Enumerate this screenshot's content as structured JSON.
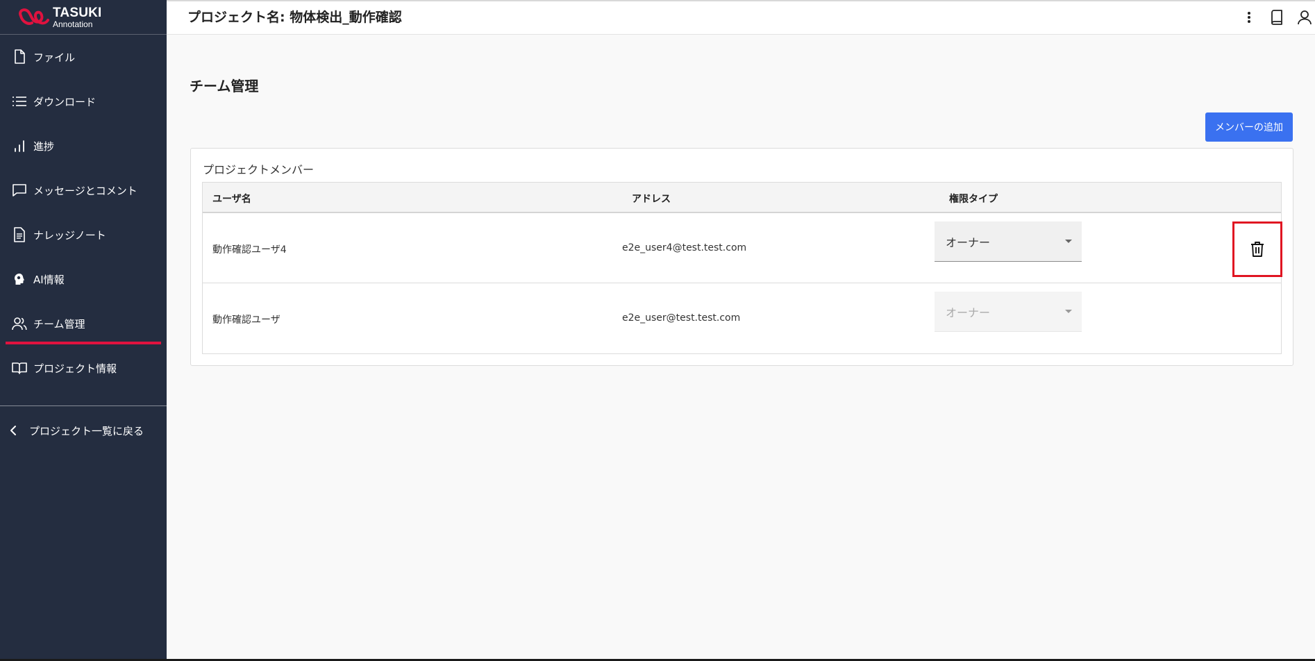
{
  "brand": {
    "name": "TASUKI",
    "sub": "Annotation",
    "accent": "#e0123f"
  },
  "sidebar": {
    "items": [
      {
        "label": "ファイル",
        "icon": "file-icon"
      },
      {
        "label": "ダウンロード",
        "icon": "list-icon"
      },
      {
        "label": "進捗",
        "icon": "bar-chart-icon"
      },
      {
        "label": "メッセージとコメント",
        "icon": "message-icon"
      },
      {
        "label": "ナレッジノート",
        "icon": "document-icon"
      },
      {
        "label": "AI情報",
        "icon": "ai-head-icon"
      },
      {
        "label": "チーム管理",
        "icon": "users-icon",
        "active": true
      },
      {
        "label": "プロジェクト情報",
        "icon": "book-icon"
      }
    ],
    "back_label": "プロジェクト一覧に戻る"
  },
  "header": {
    "title": "プロジェクト名: 物体検出_動作確認"
  },
  "main": {
    "heading": "チーム管理",
    "add_button": "メンバーの追加",
    "card_title": "プロジェクトメンバー",
    "columns": [
      "ユーザ名",
      "アドレス",
      "権限タイプ"
    ],
    "rows": [
      {
        "name": "動作確認ユーザ4",
        "email": "e2e_user4@test.test.com",
        "role": "オーナー",
        "disabled": false
      },
      {
        "name": "動作確認ユーザ",
        "email": "e2e_user@test.test.com",
        "role": "オーナー",
        "disabled": true
      }
    ]
  },
  "colors": {
    "sidebar_bg": "#242d40",
    "primary_button": "#3a71f0",
    "highlight_box": "#e01522"
  }
}
